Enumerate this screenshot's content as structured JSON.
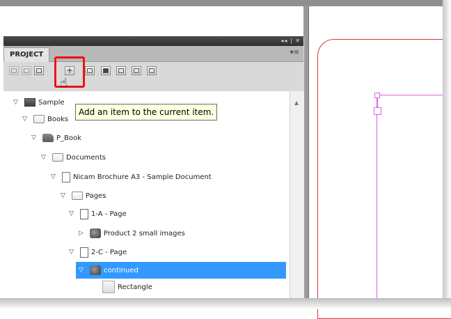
{
  "panel": {
    "tab_label": "PROJECT",
    "collapse_label": "◂◂ | ✕",
    "menu_label": "▾≡"
  },
  "toolbar": {
    "buttons": [
      "locate",
      "save",
      "properties",
      "add-item",
      "new-page",
      "group",
      "frame",
      "preview",
      "export"
    ]
  },
  "tooltip": {
    "text": "Add an item to the current item."
  },
  "tree": {
    "items": [
      {
        "label": "Sample",
        "icon": "sample-icon",
        "twisty": "▽"
      },
      {
        "label": "Books",
        "icon": "folder-icon",
        "twisty": "▽"
      },
      {
        "label": "P_Book",
        "icon": "book-icon",
        "twisty": "▽"
      },
      {
        "label": "Documents",
        "icon": "folder-icon",
        "twisty": "▽"
      },
      {
        "label": "Nicam Brochure A3 - Sample Document",
        "icon": "document-icon",
        "twisty": "▽"
      },
      {
        "label": "Pages",
        "icon": "folder-icon",
        "twisty": "▽"
      },
      {
        "label": "1-A - Page",
        "icon": "page-icon",
        "twisty": "▽"
      },
      {
        "label": "Product 2 small images",
        "icon": "group-icon",
        "twisty": "▷"
      },
      {
        "label": "2-C - Page",
        "icon": "page-icon",
        "twisty": "▽"
      },
      {
        "label": "continued",
        "icon": "group-icon",
        "twisty": "▽",
        "selected": true
      },
      {
        "label": "Rectangle",
        "icon": "rectangle-icon",
        "twisty": ""
      }
    ]
  },
  "colors": {
    "highlight_box": "#ee1111",
    "selection": "#3399ff",
    "page_margin": "#e0303a",
    "frame_guide": "#e060e0",
    "tooltip_bg": "#ffffe1"
  }
}
